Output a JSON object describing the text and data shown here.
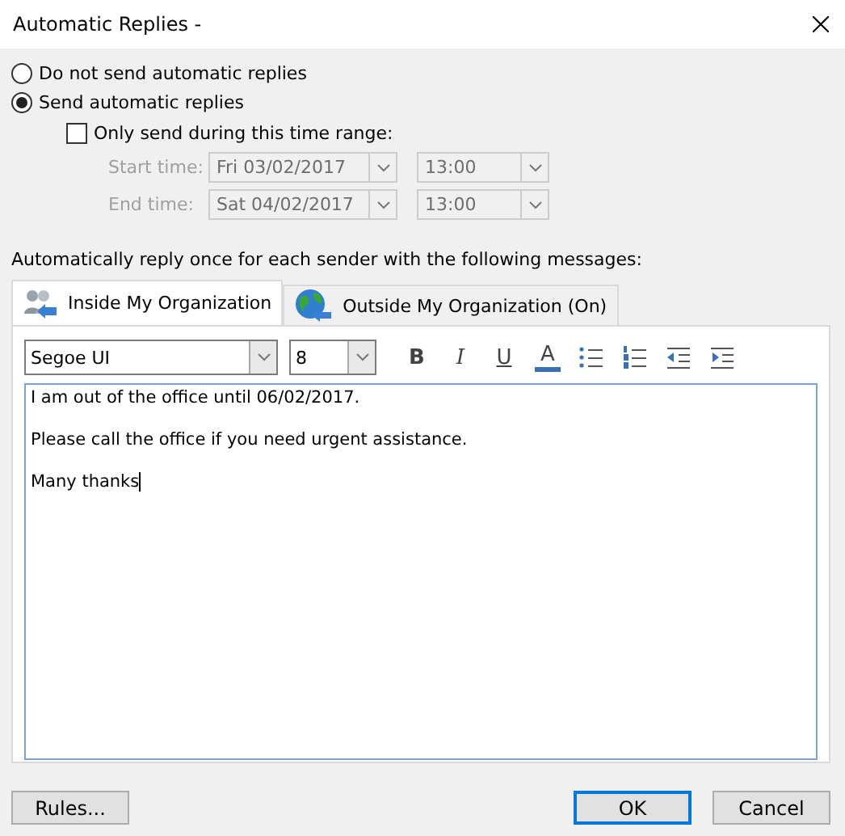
{
  "window": {
    "title": "Automatic Replies -"
  },
  "reply_options": [
    {
      "label": "Do not send automatic replies",
      "selected": false
    },
    {
      "label": "Send automatic replies",
      "selected": true
    }
  ],
  "time_range": {
    "label": "Only send during this time range:",
    "checked": false,
    "rows": [
      {
        "label": "Start time:",
        "date": "Fri 03/02/2017",
        "time": "13:00"
      },
      {
        "label": "End time:",
        "date": "Sat 04/02/2017",
        "time": "13:00"
      }
    ]
  },
  "instructions": "Automatically reply once for each sender with the following messages:",
  "tabs": [
    {
      "label": "Inside My Organization",
      "kind": "people",
      "selected": true
    },
    {
      "label": "Outside My Organization (On)",
      "kind": "globe",
      "selected": false
    }
  ],
  "toolbar": {
    "font": "Segoe UI",
    "size": "8",
    "buttons": [
      {
        "kind": "bold",
        "label": "B"
      },
      {
        "kind": "italic",
        "label": "I"
      },
      {
        "kind": "underline",
        "label": "U"
      },
      {
        "kind": "color",
        "label": "A"
      },
      {
        "kind": "bullets"
      },
      {
        "kind": "numbering"
      },
      {
        "kind": "outdent"
      },
      {
        "kind": "indent"
      }
    ]
  },
  "message": [
    "I am out of the office until 06/02/2017.",
    "Please call the office if you need urgent assistance.",
    "Many thanks"
  ],
  "buttons": [
    {
      "label": "Rules...",
      "default": false
    },
    {
      "label": "OK",
      "default": true
    },
    {
      "label": "Cancel",
      "default": false
    }
  ]
}
